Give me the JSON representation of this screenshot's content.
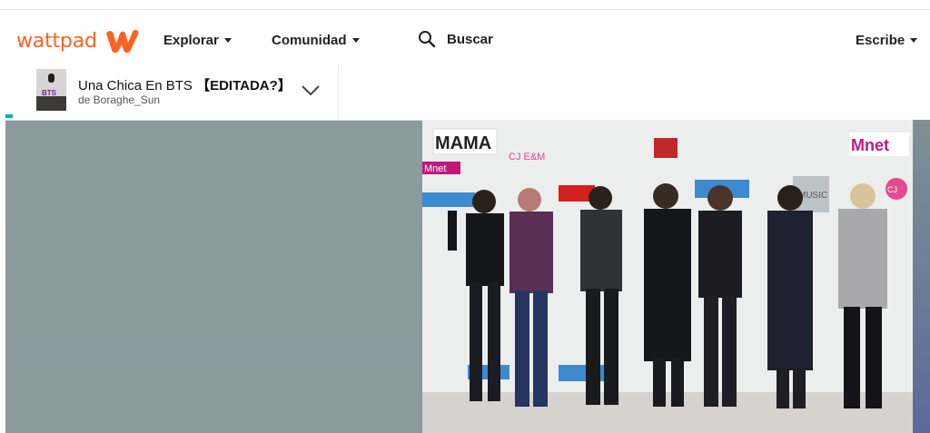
{
  "header": {
    "logo_text": "wattpad",
    "nav_explore": "Explorar",
    "nav_community": "Comunidad",
    "search_label": "Buscar",
    "write_label": "Escribe"
  },
  "story": {
    "title_main": "Una Chica En BTS",
    "title_suffix": "【EDITADA?】",
    "author": "de Boraghe_Sun",
    "cover_text": "BTS"
  },
  "photo": {
    "wall_labels": [
      "MAMA",
      "Mnet",
      "CJ E&M",
      "Mnet",
      "MUSIC",
      "CJ"
    ]
  },
  "colors": {
    "brand": "#ff6122",
    "progress": "#00b2b2",
    "hero_bg": "#8b9c9f"
  }
}
